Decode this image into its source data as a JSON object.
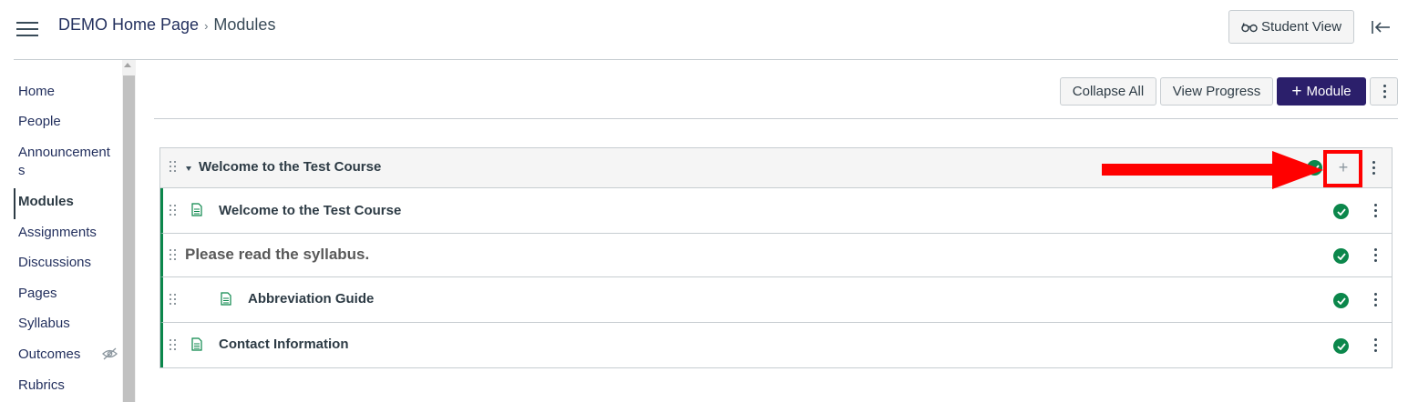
{
  "header": {
    "breadcrumb": {
      "home_label": "DEMO Home Page",
      "separator": "›",
      "current_label": "Modules"
    },
    "student_view_label": "Student View",
    "student_view_icon": "glasses-icon",
    "collapse_icon": "collapse-nav-icon"
  },
  "leftnav": {
    "items": [
      {
        "label": "Home"
      },
      {
        "label": "People"
      },
      {
        "label": "Announcement",
        "label_wrap": "s"
      },
      {
        "label": "Modules",
        "active": true
      },
      {
        "label": "Assignments"
      },
      {
        "label": "Discussions"
      },
      {
        "label": "Pages"
      },
      {
        "label": "Syllabus"
      },
      {
        "label": "Outcomes",
        "icon": "eye-hidden-icon"
      },
      {
        "label": "Rubrics"
      }
    ]
  },
  "toolbar": {
    "collapse_all_label": "Collapse All",
    "view_progress_label": "View Progress",
    "add_module_plus": "+",
    "add_module_label": "Module",
    "more_icon": "kebab-icon"
  },
  "module": {
    "title": "Welcome to the Test Course",
    "add_item_glyph": "+",
    "items": [
      {
        "title": "Welcome to the Test Course",
        "type": "page",
        "indent": 0
      },
      {
        "title": "Please read the syllabus.",
        "type": "text-header",
        "indent": 0
      },
      {
        "title": "Abbreviation Guide",
        "type": "page",
        "indent": 1
      },
      {
        "title": "Contact Information",
        "type": "page",
        "indent": 0
      }
    ]
  },
  "colors": {
    "accent": "#2b1f6b",
    "link": "#23305e",
    "published_green": "#0b874b",
    "annotation_red": "#ff0000"
  }
}
